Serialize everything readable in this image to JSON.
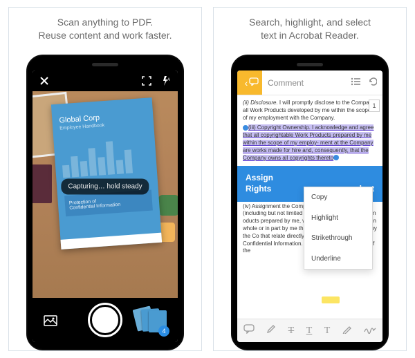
{
  "panels": {
    "left": {
      "caption_line1": "Scan anything to PDF.",
      "caption_line2": "Reuse content and work faster.",
      "scan": {
        "toast": "Capturing… hold steady",
        "document": {
          "title": "Global Corp",
          "subtitle": "Employee Handbook",
          "band_line1": "Protection of",
          "band_line2": "Confidential Information"
        },
        "stack_count": "4"
      }
    },
    "right": {
      "caption_line1": "Search, highlight, and select",
      "caption_line2": "text in Acrobat Reader.",
      "acrobat": {
        "header_title": "Comment",
        "page_number": "1",
        "context_menu": {
          "copy": "Copy",
          "highlight": "Highlight",
          "strike": "Strikethrough",
          "underline": "Underline"
        },
        "heading_line1": "Assign",
        "heading_line2": "Rights",
        "heading_suffix": "oduct",
        "body": {
          "p1_lead": "(ii) Disclosure.",
          "p1_rest": " I will promptly disclose to the Company all Work Products developed by me within the scope of my employment with the Company.",
          "p2_lead": "(iii) Copyright Ownership.",
          "p2_rest": " I acknowledge and agree that all copyrightable Work Products prepared by me within the scope of my employ- ment at the Company are works made for hire and, consequently, that the Company owns all copyrights thereto",
          "p3_lead": "(iv) Assignment",
          "p3_rest": " the Company all of my other rest (including but not limited to , and trade secret rights) in oducts prepared by me, whether made or conceived in whole or in part by me the scope of my employment by the Co that relate directly to, or involve the use of Confidential Information. Pursuant to the provisions of the"
        }
      }
    }
  }
}
